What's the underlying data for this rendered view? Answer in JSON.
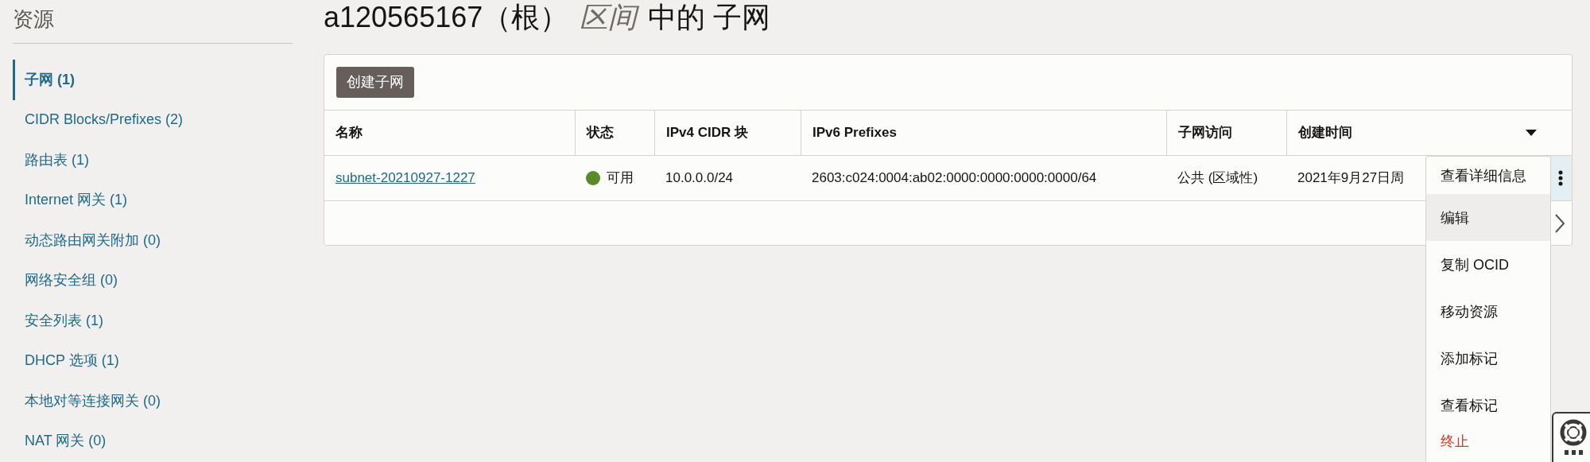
{
  "sidebar": {
    "title": "资源",
    "items": [
      {
        "label": "子网 (1)",
        "selected": true
      },
      {
        "label": "CIDR Blocks/Prefixes (2)",
        "selected": false
      },
      {
        "label": "路由表 (1)",
        "selected": false
      },
      {
        "label": "Internet 网关 (1)",
        "selected": false
      },
      {
        "label": "动态路由网关附加 (0)",
        "selected": false
      },
      {
        "label": "网络安全组 (0)",
        "selected": false
      },
      {
        "label": "安全列表 (1)",
        "selected": false
      },
      {
        "label": "DHCP 选项 (1)",
        "selected": false
      },
      {
        "label": "本地对等连接网关 (0)",
        "selected": false
      },
      {
        "label": "NAT 网关 (0)",
        "selected": false
      }
    ]
  },
  "page_title": {
    "prefix": "a120565167（根）",
    "emphasis": "区间",
    "suffix": "中的 子网"
  },
  "create_button": "创建子网",
  "table": {
    "columns": [
      "名称",
      "状态",
      "IPv4 CIDR 块",
      "IPv6 Prefixes",
      "子网访问",
      "创建时间"
    ],
    "rows": [
      {
        "name": "subnet-20210927-1227",
        "status": {
          "text": "可用",
          "color": "#5a8a2a"
        },
        "ipv4": "10.0.0.0/24",
        "ipv6": "2603:c024:0004:ab02:0000:0000:0000:0000/64",
        "access": "公共 (区域性)",
        "created": "2021年9月27日周"
      }
    ]
  },
  "menu": [
    {
      "label": "查看详细信息",
      "kind": "normal",
      "selected": false
    },
    {
      "label": "编辑",
      "kind": "normal",
      "selected": true
    },
    {
      "label": "复制 OCID",
      "kind": "normal",
      "selected": false
    },
    {
      "label": "移动资源",
      "kind": "normal",
      "selected": false
    },
    {
      "label": "添加标记",
      "kind": "normal",
      "selected": false
    },
    {
      "label": "查看标记",
      "kind": "normal",
      "selected": false
    },
    {
      "label": "终止",
      "kind": "danger",
      "selected": false
    }
  ]
}
